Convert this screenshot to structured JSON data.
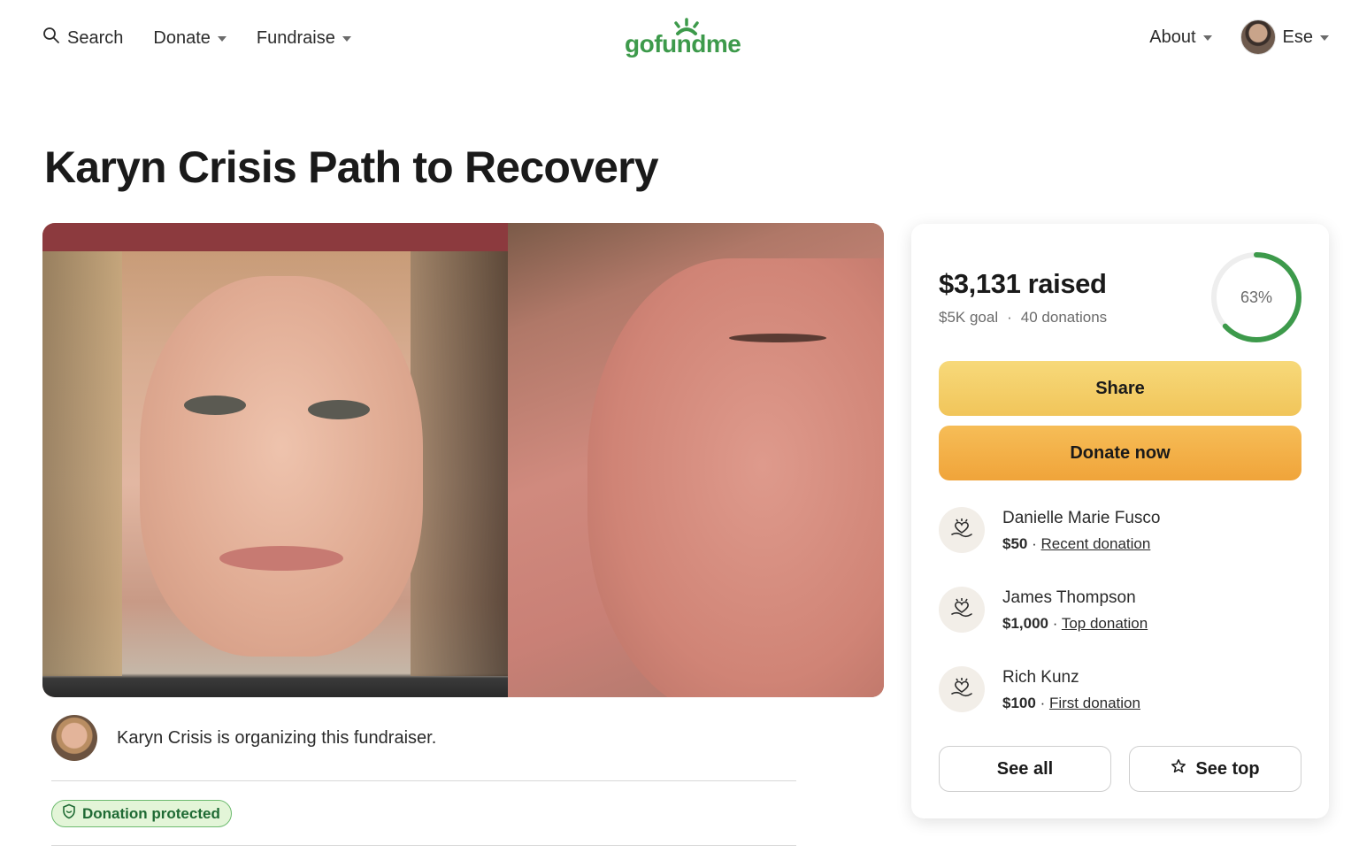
{
  "nav": {
    "search_label": "Search",
    "donate_label": "Donate",
    "fundraise_label": "Fundraise",
    "about_label": "About",
    "user_name": "Ese"
  },
  "logo": {
    "text": "gofundme",
    "color": "#3d9a4b"
  },
  "page": {
    "title": "Karyn Crisis Path to Recovery"
  },
  "organizer": {
    "text": "Karyn Crisis is organizing this fundraiser."
  },
  "badge": {
    "label": "Donation protected"
  },
  "card": {
    "raised": "$3,131 raised",
    "goal": "$5K goal",
    "separator": "·",
    "donations": "40 donations",
    "progress_percent": 63,
    "progress_label": "63%",
    "share_label": "Share",
    "donate_label": "Donate now",
    "see_all_label": "See all",
    "see_top_label": "See top"
  },
  "donations": [
    {
      "name": "Danielle Marie Fusco",
      "amount": "$50",
      "type": "Recent donation"
    },
    {
      "name": "James Thompson",
      "amount": "$1,000",
      "type": "Top donation"
    },
    {
      "name": "Rich Kunz",
      "amount": "$100",
      "type": "First donation"
    }
  ],
  "colors": {
    "accent_green": "#3d9a4b",
    "share_yellow": "#f1c55a",
    "donate_orange": "#f0a43a",
    "badge_bg": "#e3f5d8"
  }
}
